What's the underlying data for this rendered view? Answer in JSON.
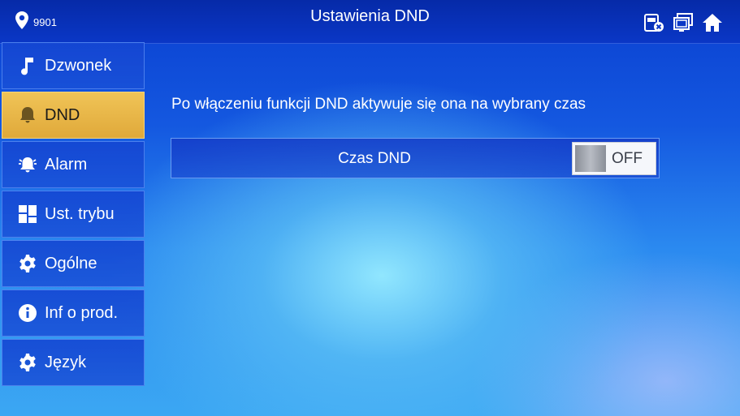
{
  "header": {
    "location_id": "9901",
    "title": "Ustawienia DND",
    "icons": [
      "missed-call-icon",
      "monitor-icon",
      "home-icon"
    ]
  },
  "sidebar": {
    "items": [
      {
        "label": "Dzwonek",
        "icon": "music-note-icon"
      },
      {
        "label": "DND",
        "icon": "bell-icon",
        "active": true
      },
      {
        "label": "Alarm",
        "icon": "alarm-bell-icon"
      },
      {
        "label": "Ust. trybu",
        "icon": "grid-icon"
      },
      {
        "label": "Ogólne",
        "icon": "gear-icon"
      },
      {
        "label": "Inf o prod.",
        "icon": "info-icon"
      },
      {
        "label": "Język",
        "icon": "gear-icon"
      }
    ]
  },
  "main": {
    "description": "Po włączeniu funkcji DND aktywuje się ona na wybrany czas",
    "dnd_time_label": "Czas DND",
    "toggle_state": "OFF"
  },
  "colors": {
    "active_item": "#e8b648",
    "topbar": "#0a37c6",
    "background": "#2b8af0"
  }
}
